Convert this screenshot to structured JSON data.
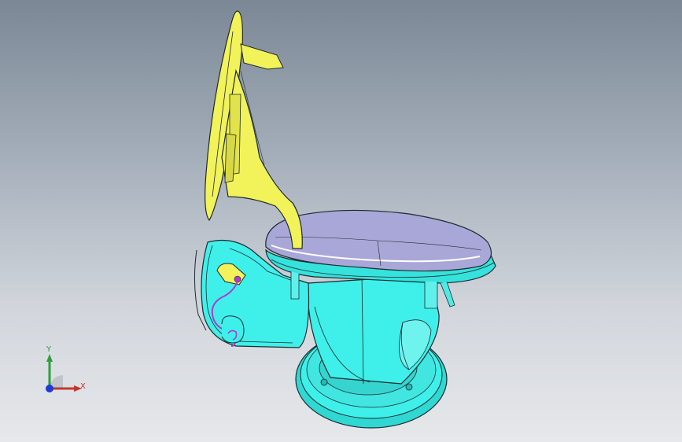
{
  "viewport": {
    "background_top": "#7c8796",
    "background_bottom": "#e6e8eb"
  },
  "model": {
    "lid_color": "#f2f25a",
    "body_color": "#3ff0ea",
    "seat_color": "#a9a7d8",
    "spring_color": "#b03ad0",
    "edge_color": "#1c2a2e"
  },
  "triad": {
    "y_label": "Y",
    "x_label": "X",
    "y_color": "#2e9f3a",
    "x_color": "#c0392b",
    "origin_color": "#1f3bd6"
  }
}
